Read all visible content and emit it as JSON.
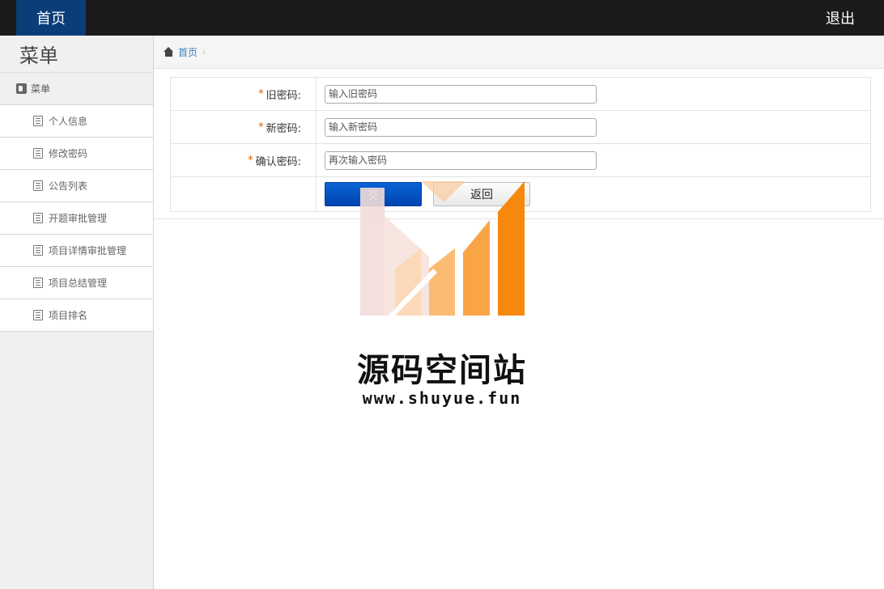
{
  "topbar": {
    "home_label": "首页",
    "logout_label": "退出"
  },
  "sidebar": {
    "title": "菜单",
    "group_label": "菜单",
    "items": [
      {
        "label": "个人信息"
      },
      {
        "label": "修改密码"
      },
      {
        "label": "公告列表"
      },
      {
        "label": "开题审批管理"
      },
      {
        "label": "项目详情审批管理"
      },
      {
        "label": "项目总结管理"
      },
      {
        "label": "项目排名"
      }
    ]
  },
  "breadcrumb": {
    "home": "首页",
    "separator": "›"
  },
  "form": {
    "required_mark": "*",
    "old_password": {
      "label": "旧密码:",
      "placeholder": "输入旧密码"
    },
    "new_password": {
      "label": "新密码:",
      "placeholder": "输入新密码"
    },
    "confirm_password": {
      "label": "确认密码:",
      "placeholder": "再次输入密码"
    },
    "submit_label": "交",
    "back_label": "返回"
  },
  "watermark": {
    "text": "源码空间站",
    "url": "www.shuyue.fun"
  },
  "colors": {
    "topbar": "#1b1b1b",
    "home_tab": "#0b3d78",
    "submit": "#0a5bd0",
    "required": "#e06000",
    "logo_orange": "#f7880e"
  },
  "icons": {
    "breadcrumb_home": "home-icon",
    "group": "menu-group-icon",
    "item": "document-icon"
  }
}
